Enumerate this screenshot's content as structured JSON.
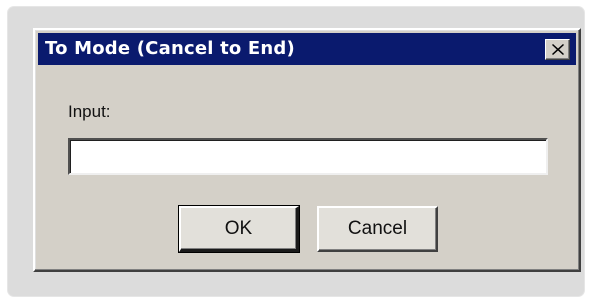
{
  "dialog": {
    "title": "To Mode (Cancel to End)",
    "close_icon": "close-x-icon",
    "input_label": "Input:",
    "input_value": "",
    "ok_label": "OK",
    "cancel_label": "Cancel"
  },
  "colors": {
    "titlebar": "#0a1a6e",
    "dialog_face": "#d4d0c8",
    "frame_background": "#dcdcdc"
  }
}
